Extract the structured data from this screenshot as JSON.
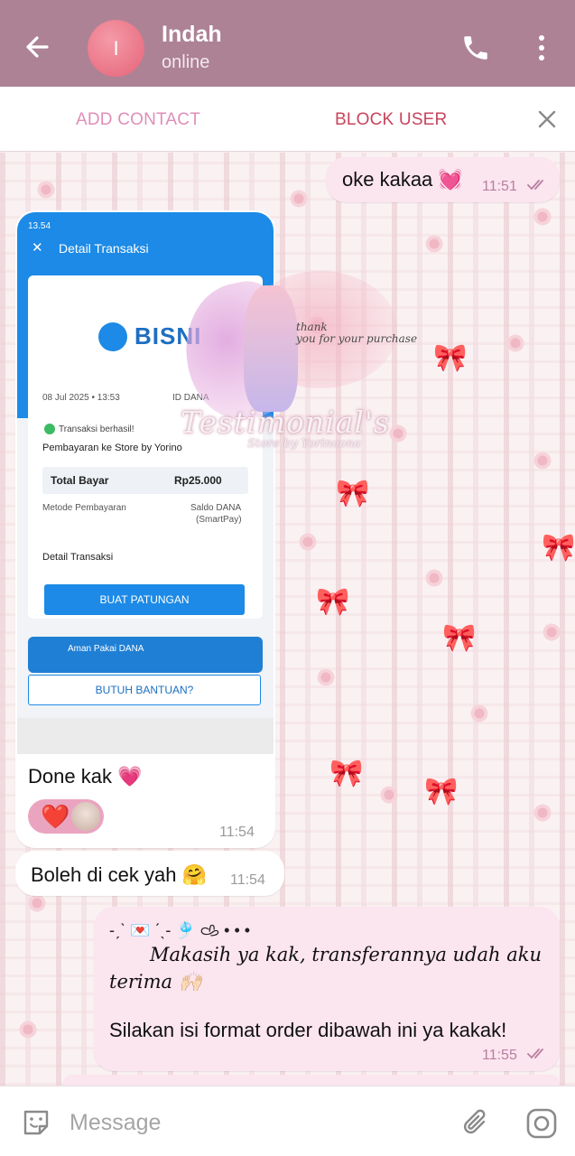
{
  "header": {
    "contact_name": "Indah",
    "status": "online",
    "avatar_initial": "I",
    "color": "#ad8295"
  },
  "actions": {
    "add_contact": "ADD CONTACT",
    "block_user": "BLOCK USER"
  },
  "messages": [
    {
      "id": "m1",
      "direction": "out",
      "text": "oke kakaa 💓",
      "time": "11:51",
      "read": true
    },
    {
      "id": "m2",
      "direction": "in",
      "type": "image",
      "caption": "Done kak 💗",
      "time": "11:54",
      "reactions": [
        "❤️"
      ]
    },
    {
      "id": "m3",
      "direction": "in",
      "text": "Boleh di cek yah 🤗",
      "time": "11:54"
    },
    {
      "id": "m4",
      "direction": "out",
      "line1": "-ˏˋ 💌 ˊˎ- 🎐 𐚁 • • •",
      "line2": "Makasih ya kak, transferannya udah aku terima 🙌🏻",
      "line3": "Silakan isi format order dibawah ini ya kakak!",
      "time": "11:55",
      "read": true
    }
  ],
  "screenshot": {
    "status_time": "13.54",
    "title": "Detail Transaksi",
    "brand": "BISNI",
    "date": "08 Jul 2025 • 13:53",
    "id_label": "ID DANA",
    "success": "Transaksi berhasil!",
    "payment_to": "Pembayaran ke Store by Yorino",
    "total_label": "Total Bayar",
    "total_value": "Rp25.000",
    "method_label": "Metode Pembayaran",
    "method_value1": "Saldo DANA",
    "method_value2": "(SmartPay)",
    "detail_label": "Detail Transaksi",
    "button": "BUAT PATUNGAN",
    "promo": "Aman Pakai DANA",
    "help": "BUTUH BANTUAN?",
    "overlay_script1": "thank",
    "overlay_script2": "you for your purchase",
    "overlay_title": "Testimonial's",
    "overlay_store": "Store by Yorinoona"
  },
  "composer": {
    "placeholder": "Message"
  },
  "colors": {
    "outgoing_bubble": "#fbe5ef",
    "incoming_bubble": "#ffffff",
    "block_red": "#c8445c",
    "add_pink": "#df8fb8"
  }
}
